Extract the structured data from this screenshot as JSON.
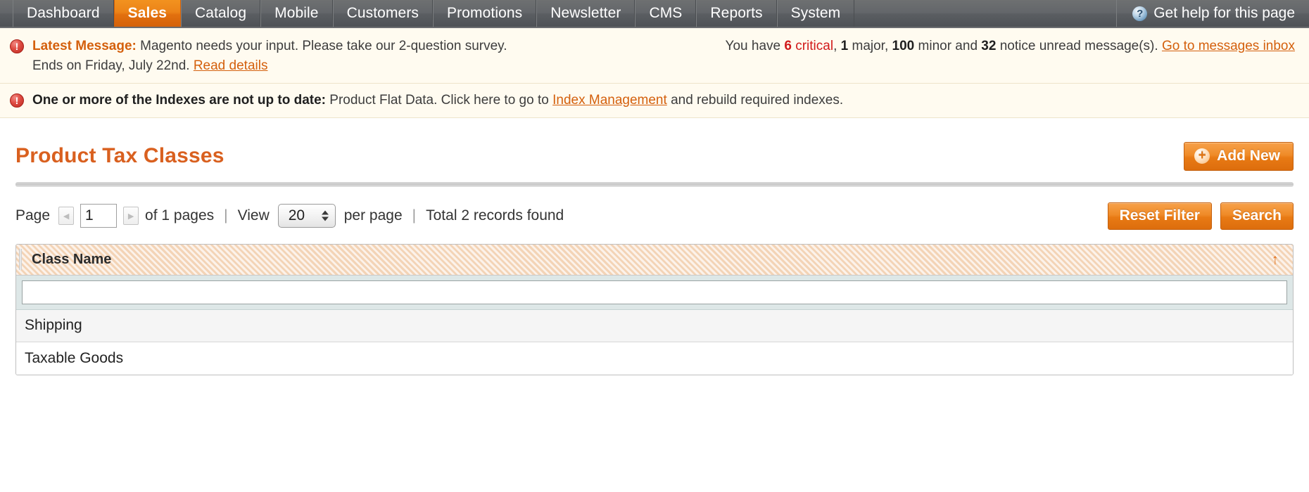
{
  "nav": {
    "items": [
      {
        "label": "Dashboard",
        "active": false
      },
      {
        "label": "Sales",
        "active": true
      },
      {
        "label": "Catalog",
        "active": false
      },
      {
        "label": "Mobile",
        "active": false
      },
      {
        "label": "Customers",
        "active": false
      },
      {
        "label": "Promotions",
        "active": false
      },
      {
        "label": "Newsletter",
        "active": false
      },
      {
        "label": "CMS",
        "active": false
      },
      {
        "label": "Reports",
        "active": false
      },
      {
        "label": "System",
        "active": false
      }
    ],
    "help_label": "Get help for this page",
    "help_icon": "question-mark-circle-icon",
    "active_color": "#e2700e"
  },
  "messages": {
    "latest": {
      "icon": "error-circle-icon",
      "label": "Latest Message:",
      "text_line1": "Magento needs your input. Please take our 2-question survey.",
      "text_line2": "Ends on Friday, July 22nd.",
      "read_details_link": "Read details",
      "counts_prefix": "You have",
      "critical_count": "6",
      "critical_word": "critical",
      "comma1": ",",
      "major_count": "1",
      "major_word": "major,",
      "minor_count": "100",
      "minor_word": "minor and",
      "notice_count": "32",
      "notice_word": "notice unread message(s).",
      "inbox_link": "Go to messages inbox"
    },
    "index": {
      "icon": "error-circle-icon",
      "label": "One or more of the Indexes are not up to date:",
      "text_before": "Product Flat Data. Click here to go to",
      "link": "Index Management",
      "text_after": "and rebuild required indexes."
    }
  },
  "page": {
    "title": "Product Tax Classes",
    "add_new_label": "Add New",
    "add_new_icon": "plus-circle-icon",
    "title_color": "#d9601f"
  },
  "pager": {
    "page_label": "Page",
    "prev_icon": "chevron-left-icon",
    "next_icon": "chevron-right-icon",
    "page_value": "1",
    "of_pages": "of 1 pages",
    "sep": "|",
    "view_label": "View",
    "per_page_value": "20",
    "per_page_label": "per page",
    "total_records": "Total 2 records found",
    "reset_filter_label": "Reset Filter",
    "search_label": "Search"
  },
  "grid": {
    "column_header": "Class Name",
    "sort_icon": "sort-ascending-arrow-icon",
    "sort_direction": "asc",
    "filter_value": "",
    "filter_placeholder": "",
    "rows": [
      {
        "class_name": "Shipping"
      },
      {
        "class_name": "Taxable Goods"
      }
    ]
  }
}
